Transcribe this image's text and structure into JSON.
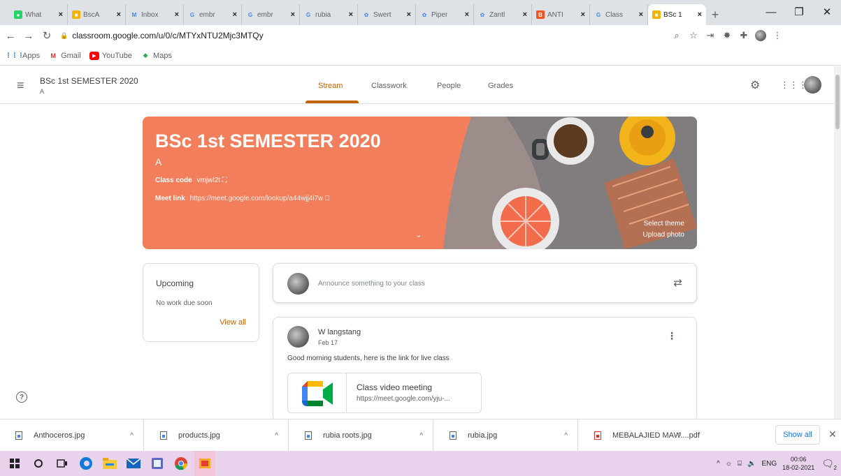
{
  "browser": {
    "tabs": [
      {
        "label": "What",
        "favicon_color": "#25d366",
        "favicon_char": "●"
      },
      {
        "label": "BscA",
        "favicon_color": "#f4b400",
        "favicon_char": "■"
      },
      {
        "label": "Inbox",
        "favicon_color": "#ffffff",
        "favicon_char": "M"
      },
      {
        "label": "embr",
        "favicon_color": "#ffffff",
        "favicon_char": "G"
      },
      {
        "label": "embr",
        "favicon_color": "#ffffff",
        "favicon_char": "G"
      },
      {
        "label": "rubia",
        "favicon_color": "#ffffff",
        "favicon_char": "G"
      },
      {
        "label": "Swert",
        "favicon_color": "#ffffff",
        "favicon_char": "✿"
      },
      {
        "label": "Piper",
        "favicon_color": "#ffffff",
        "favicon_char": "✿"
      },
      {
        "label": "Zantl",
        "favicon_color": "#ffffff",
        "favicon_char": "✿"
      },
      {
        "label": "ANTI",
        "favicon_color": "#f4511e",
        "favicon_char": "B"
      },
      {
        "label": "Class",
        "favicon_color": "#ffffff",
        "favicon_char": "G"
      },
      {
        "label": "BSc 1",
        "favicon_color": "#f4b400",
        "favicon_char": "■"
      }
    ],
    "url": "classroom.google.com/u/0/c/MTYxNTU2Mjc3MTQy",
    "bookmarks": [
      {
        "label": "Apps",
        "icon": "apps-grid-icon"
      },
      {
        "label": "Gmail",
        "icon": "gmail-icon"
      },
      {
        "label": "YouTube",
        "icon": "youtube-icon"
      },
      {
        "label": "Maps",
        "icon": "maps-icon"
      }
    ]
  },
  "classroom": {
    "header_title": "BSc 1st SEMESTER 2020",
    "header_section": "A",
    "nav_tabs": [
      "Stream",
      "Classwork",
      "People",
      "Grades"
    ],
    "active_tab": "Stream",
    "accent": "#c26401"
  },
  "banner": {
    "title": "BSc 1st SEMESTER 2020",
    "section": "A",
    "class_code_label": "Class code",
    "class_code": "vmjwl2t",
    "meet_link_label": "Meet link",
    "meet_link": "https://meet.google.com/lookup/a44wjj4i7w",
    "select_theme": "Select theme",
    "upload_photo": "Upload photo",
    "color": "#f37e5b"
  },
  "upcoming": {
    "title": "Upcoming",
    "empty": "No work due soon",
    "view_all": "View all"
  },
  "announce": {
    "placeholder": "Announce something to your class"
  },
  "post": {
    "author": "W langstang",
    "date": "Feb 17",
    "text": "Good morning students, here is the link for live class",
    "attachment_title": "Class video meeting",
    "attachment_url": "https://meet.google.com/yju-..."
  },
  "downloads": {
    "items": [
      {
        "name": "Anthoceros.jpg",
        "type": "image"
      },
      {
        "name": "products.jpg",
        "type": "image"
      },
      {
        "name": "rubia roots.jpg",
        "type": "image"
      },
      {
        "name": "rubia.jpg",
        "type": "image"
      },
      {
        "name": "MEBALAJIED MAW....pdf",
        "type": "pdf"
      }
    ],
    "show_all": "Show all"
  },
  "taskbar": {
    "language": "ENG",
    "time": "00:06",
    "date": "18-02-2021",
    "notification_count": "2"
  }
}
